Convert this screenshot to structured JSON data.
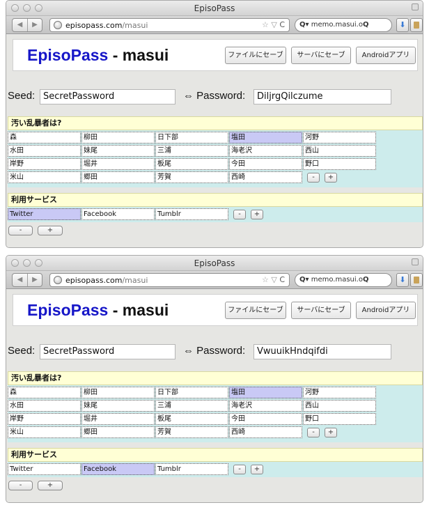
{
  "windows": [
    {
      "title": "EpisoPass",
      "url_host": "episopass.com",
      "url_path": "/masui",
      "search_text": "memo.masui.o",
      "app_title_brand": "EpisoPass",
      "app_title_rest": " - masui",
      "buttons": {
        "save_file": "ファイルにセーブ",
        "save_server": "サーバにセーブ",
        "android": "Androidアプリ"
      },
      "seed_label": "Seed:",
      "seed_value": "SecretPassword",
      "password_label": "⇔ Password:",
      "password_value": "DiljrgQilczume",
      "question": "汚い乱暴者は?",
      "answers": [
        [
          "森",
          "柳田",
          "日下部",
          "塩田",
          "河野"
        ],
        [
          "水田",
          "妹尾",
          "三浦",
          "海老沢",
          "西山"
        ],
        [
          "岸野",
          "堀井",
          "板尾",
          "今田",
          "野口"
        ],
        [
          "米山",
          "郷田",
          "芳賀",
          "西崎"
        ]
      ],
      "selected_answer": "塩田",
      "service_label": "利用サービス",
      "services": [
        "Twitter",
        "Facebook",
        "Tumblr"
      ],
      "selected_service": "Twitter",
      "minus": "-",
      "plus": "+"
    },
    {
      "title": "EpisoPass",
      "url_host": "episopass.com",
      "url_path": "/masui",
      "search_text": "memo.masui.o",
      "app_title_brand": "EpisoPass",
      "app_title_rest": " - masui",
      "buttons": {
        "save_file": "ファイルにセーブ",
        "save_server": "サーバにセーブ",
        "android": "Androidアプリ"
      },
      "seed_label": "Seed:",
      "seed_value": "SecretPassword",
      "password_label": "⇔ Password:",
      "password_value": "VwuuikHndqifdi",
      "question": "汚い乱暴者は?",
      "answers": [
        [
          "森",
          "柳田",
          "日下部",
          "塩田",
          "河野"
        ],
        [
          "水田",
          "妹尾",
          "三浦",
          "海老沢",
          "西山"
        ],
        [
          "岸野",
          "堀井",
          "板尾",
          "今田",
          "野口"
        ],
        [
          "米山",
          "郷田",
          "芳賀",
          "西崎"
        ]
      ],
      "selected_answer": "塩田",
      "service_label": "利用サービス",
      "services": [
        "Twitter",
        "Facebook",
        "Tumblr"
      ],
      "selected_service": "Facebook",
      "minus": "-",
      "plus": "+"
    }
  ]
}
